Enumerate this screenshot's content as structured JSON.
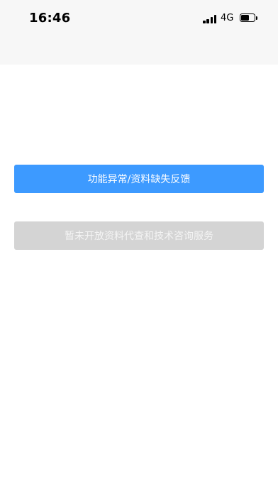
{
  "status_bar": {
    "time": "16:46",
    "network": "4G",
    "battery_level": 0.65,
    "icons": [
      "signal-icon",
      "battery-icon"
    ]
  },
  "actions": {
    "feedback_label": "功能异常/资料缺失反馈",
    "service_label": "暂未开放资料代查和技术咨询服务",
    "service_enabled": false
  },
  "colors": {
    "primary": "#3d9aff",
    "disabled": "#d4d4d4",
    "header_bg": "#f7f7f7"
  }
}
